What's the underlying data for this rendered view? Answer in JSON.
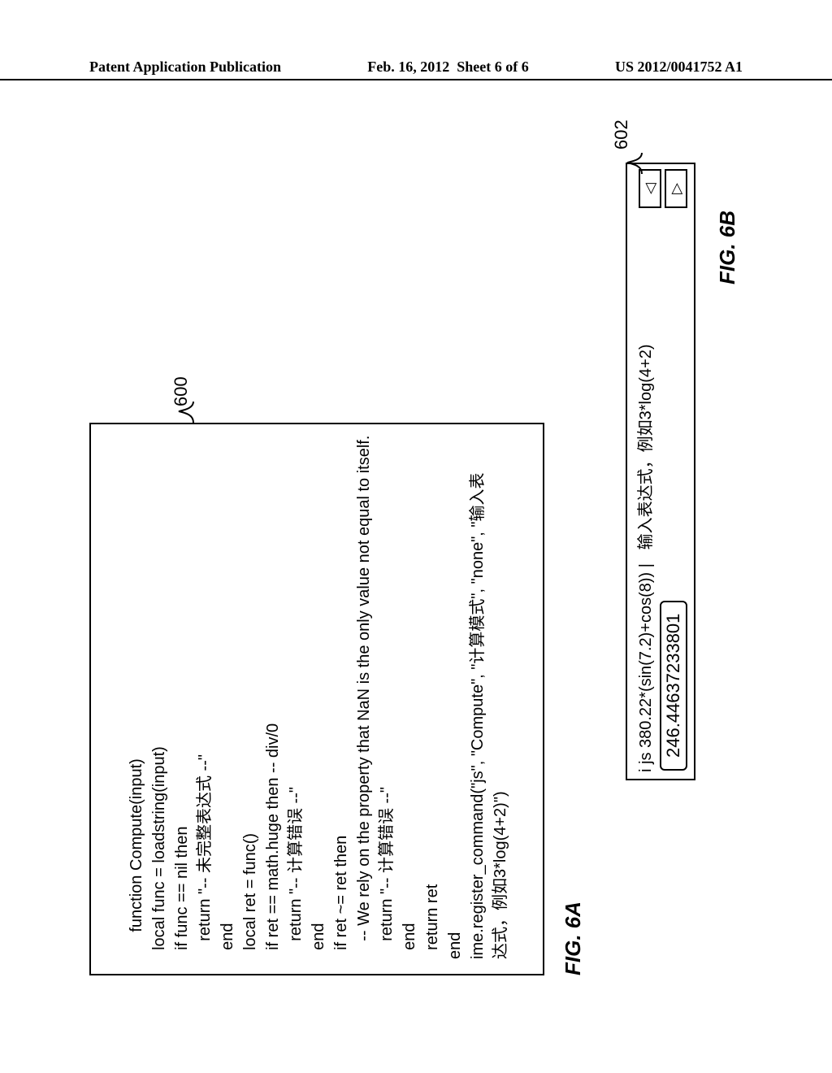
{
  "header": {
    "left": "Patent Application Publication",
    "center": "Feb. 16, 2012  Sheet 6 of 6",
    "right": "US 2012/0041752 A1"
  },
  "figA": {
    "ref": "600",
    "caption": "FIG. 6A",
    "code": "function Compute(input)\n  local func = loadstring(input)\n  if func == nil then\n    return \"-- 未完整表达式 --\"\n  end\n  local ret = func()\n  if ret == math.huge then -- div/0\n    return \"-- 计算错误 --\"\n  end\n  if ret ~= ret then\n    -- We rely on the property that NaN is the only value not equal to itself.\n    return \"-- 计算错误 --\"\n  end\n  return ret\nend\nime.register_command(\"js\", \"Compute\", \"计算模式\", \"none\", \"输入表\n达式，例如3*log(4+2)\")"
  },
  "figB": {
    "ref": "602",
    "caption": "FIG. 6B",
    "input_line": "i js 380.22*(sin(7.2)+cos(8)) |   输入表达式，例如3*log(4+2)",
    "result": "246.44637233801",
    "nav_prev_icon": "◁",
    "nav_next_icon": "▷"
  }
}
